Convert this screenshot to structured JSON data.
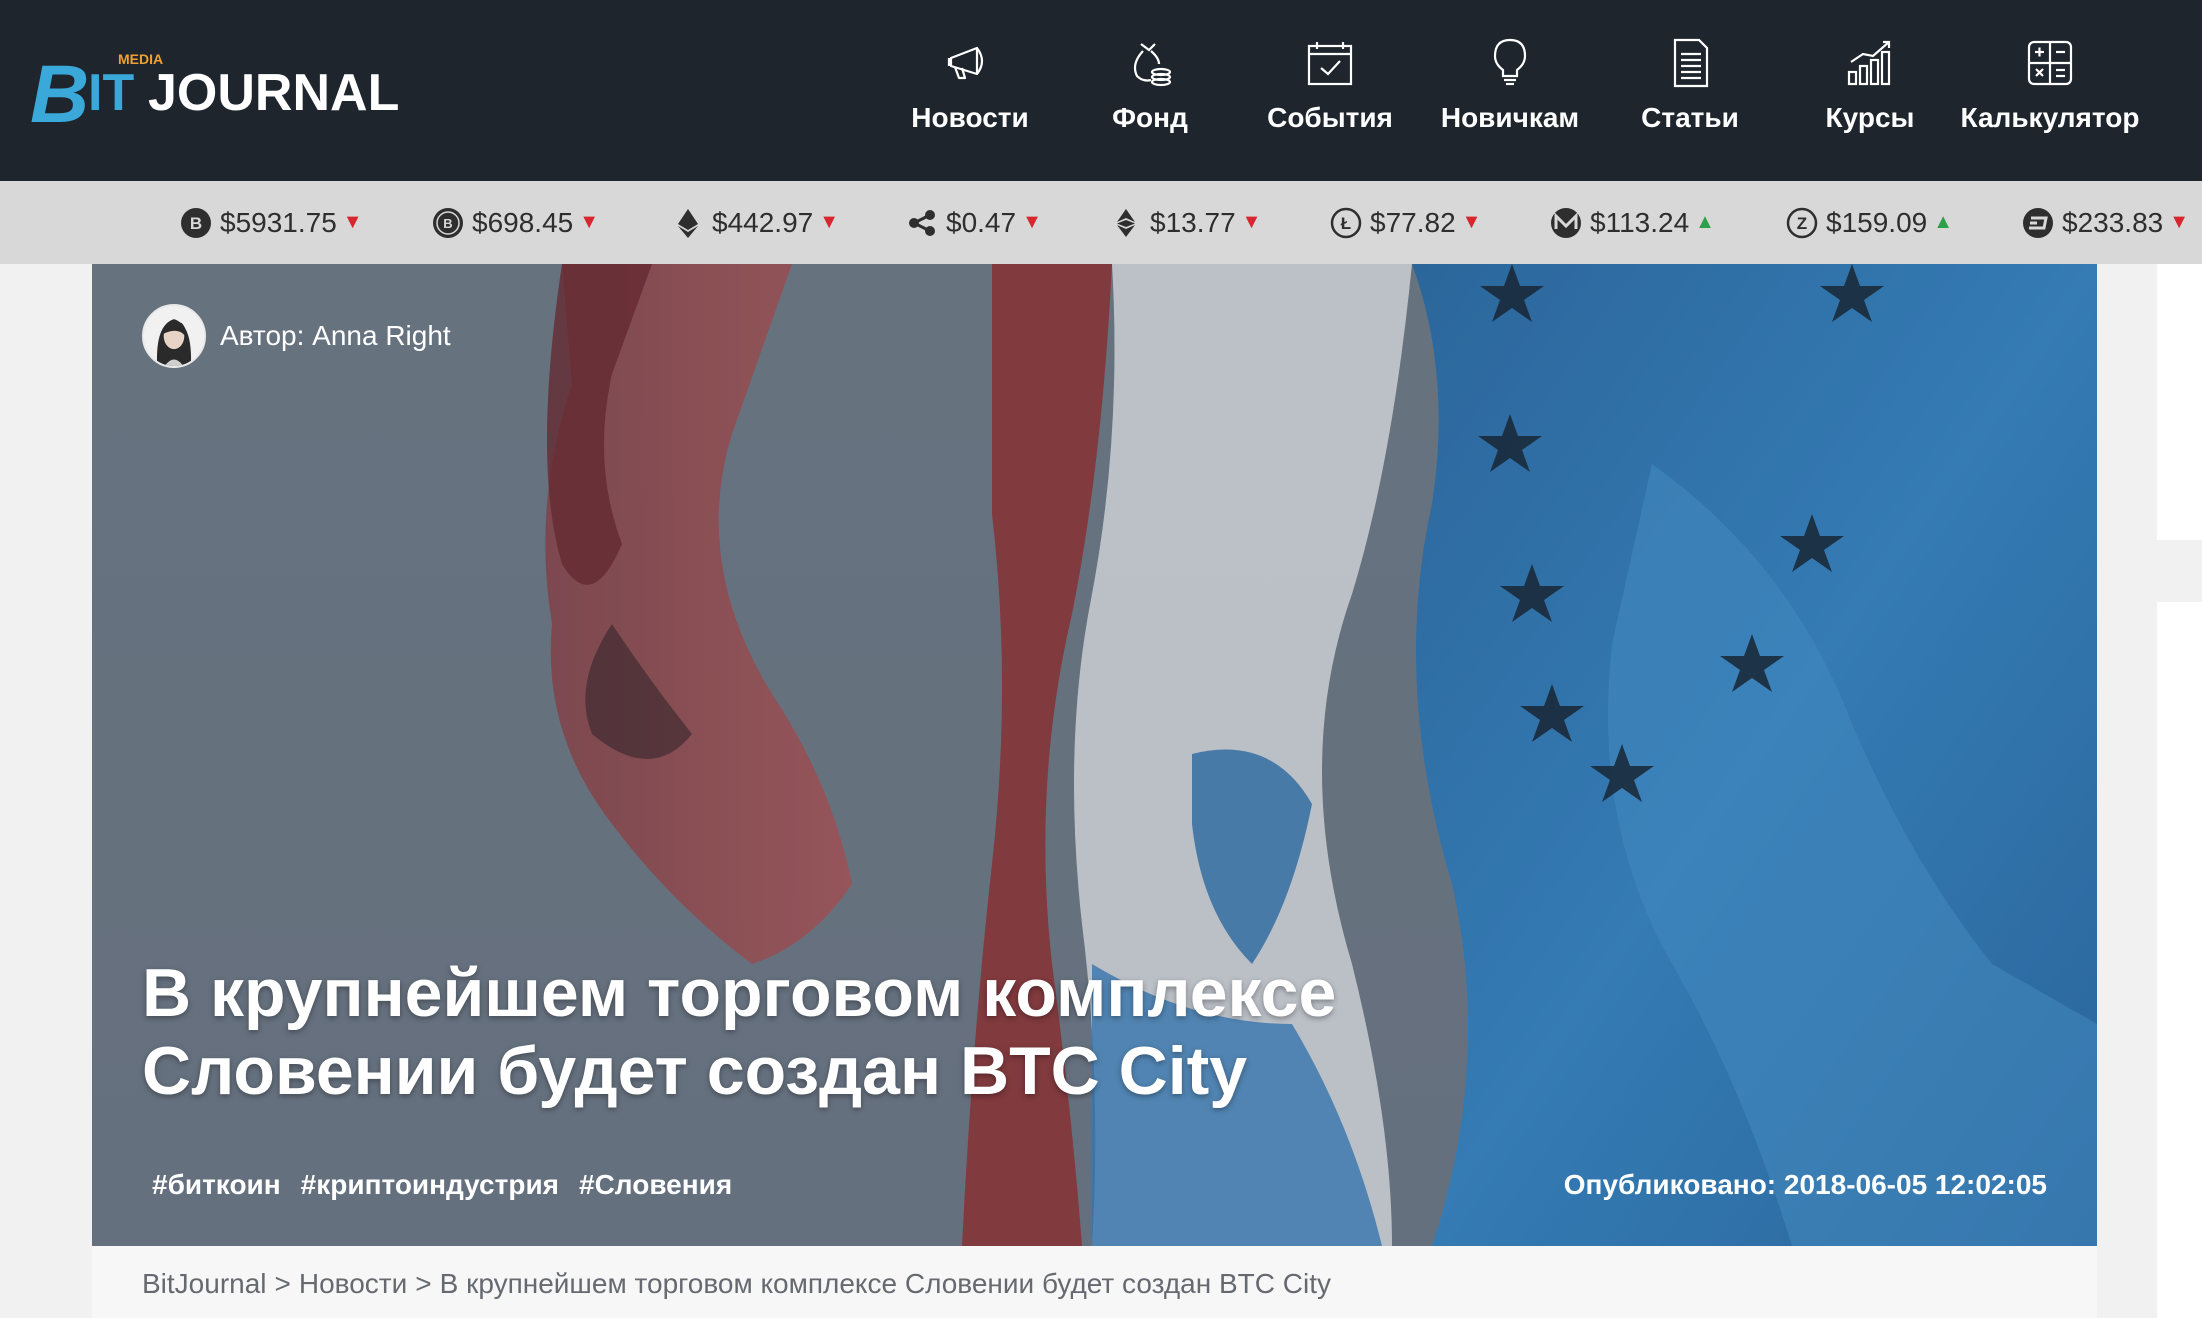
{
  "header": {
    "logo": {
      "media": "MEDIA",
      "brand_b": "B",
      "brand_it": "IT",
      "brand_rest": "JOURNAL"
    },
    "nav": [
      {
        "label": "Новости",
        "icon": "megaphone-icon"
      },
      {
        "label": "Фонд",
        "icon": "money-bag-icon"
      },
      {
        "label": "События",
        "icon": "calendar-check-icon"
      },
      {
        "label": "Новичкам",
        "icon": "lightbulb-icon"
      },
      {
        "label": "Статьи",
        "icon": "document-icon"
      },
      {
        "label": "Курсы",
        "icon": "chart-bars-icon"
      },
      {
        "label": "Калькулятор",
        "icon": "calculator-icon"
      }
    ]
  },
  "ticker": [
    {
      "coin": "bitcoin",
      "icon": "bitcoin-icon",
      "price": "$5931.75",
      "trend": "down"
    },
    {
      "coin": "bitcoin-cash",
      "icon": "bitcoin-cash-icon",
      "price": "$698.45",
      "trend": "down"
    },
    {
      "coin": "ethereum",
      "icon": "ethereum-icon",
      "price": "$442.97",
      "trend": "down"
    },
    {
      "coin": "ripple",
      "icon": "ripple-icon",
      "price": "$0.47",
      "trend": "down"
    },
    {
      "coin": "ethereum-classic",
      "icon": "ethereum-classic-icon",
      "price": "$13.77",
      "trend": "down"
    },
    {
      "coin": "litecoin",
      "icon": "litecoin-icon",
      "price": "$77.82",
      "trend": "down"
    },
    {
      "coin": "monero",
      "icon": "monero-icon",
      "price": "$113.24",
      "trend": "up"
    },
    {
      "coin": "zcash",
      "icon": "zcash-icon",
      "price": "$159.09",
      "trend": "up"
    },
    {
      "coin": "dash",
      "icon": "dash-icon",
      "price": "$233.83",
      "trend": "down"
    }
  ],
  "arrows": {
    "down": "▼",
    "up": "▲"
  },
  "colors": {
    "header_bg": "#1e252d",
    "ticker_bg": "#d8d8d8",
    "trend_down": "#d8262e",
    "trend_up": "#2fa04a",
    "logo_accent": "#3aa8d8",
    "logo_media": "#f0a030"
  },
  "article": {
    "author": "Автор: Anna Right",
    "title_line1": "В крупнейшем торговом комплексе",
    "title_line2": "Словении будет создан BTC City",
    "tags": [
      "#биткоин",
      "#криптоиндустрия",
      "#Словения"
    ],
    "published": "Опубликовано: 2018-06-05 12:02:05"
  },
  "breadcrumb": {
    "items": [
      "BitJournal",
      "Новости",
      "В крупнейшем торговом комплексе Словении будет создан BTC City"
    ],
    "separator": ">"
  }
}
